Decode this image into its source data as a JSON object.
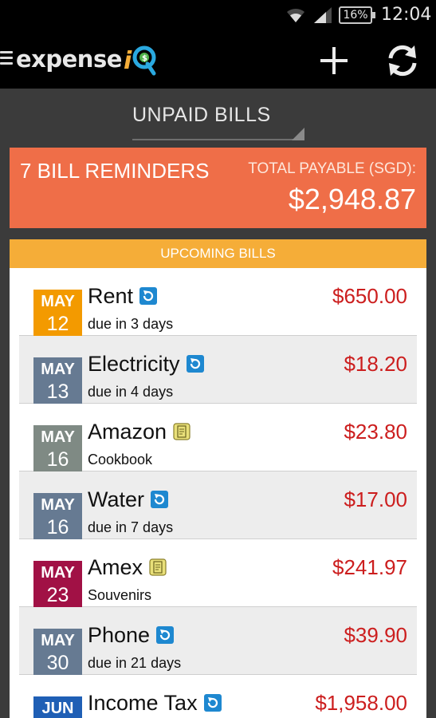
{
  "status_bar": {
    "battery": "16%",
    "time": "12:04"
  },
  "action_bar": {
    "logo_text": "expense",
    "logo_accent": "iQ",
    "icons": [
      "menu-icon",
      "plus-icon",
      "refresh-icon"
    ]
  },
  "spinner": {
    "selected": "UNPAID BILLS"
  },
  "summary": {
    "count_label": "7 BILL REMINDERS",
    "total_label": "TOTAL PAYABLE (SGD):",
    "total_value": "$2,948.87"
  },
  "list": {
    "header": "UPCOMING BILLS",
    "items": [
      {
        "month": "MAY",
        "day": "12",
        "name": "Rent",
        "sub": "due in 3 days",
        "amount": "$650.00",
        "icon": "recurring-icon",
        "badge_color": "#f39a00"
      },
      {
        "month": "MAY",
        "day": "13",
        "name": "Electricity",
        "sub": "due in 4 days",
        "amount": "$18.20",
        "icon": "recurring-icon",
        "badge_color": "#667a92"
      },
      {
        "month": "MAY",
        "day": "16",
        "name": "Amazon",
        "sub": "Cookbook",
        "amount": "$23.80",
        "icon": "note-icon",
        "badge_color": "#7f8a84"
      },
      {
        "month": "MAY",
        "day": "16",
        "name": "Water",
        "sub": "due in 7 days",
        "amount": "$17.00",
        "icon": "recurring-icon",
        "badge_color": "#667a92"
      },
      {
        "month": "MAY",
        "day": "23",
        "name": "Amex",
        "sub": "Souvenirs",
        "amount": "$241.97",
        "icon": "note-icon",
        "badge_color": "#a11145"
      },
      {
        "month": "MAY",
        "day": "30",
        "name": "Phone",
        "sub": "due in 21 days",
        "amount": "$39.90",
        "icon": "recurring-icon",
        "badge_color": "#667a92"
      },
      {
        "month": "JUN",
        "day": "",
        "name": "Income Tax",
        "sub": "",
        "amount": "$1,958.00",
        "icon": "recurring-icon",
        "badge_color": "#1f5fb5"
      }
    ]
  },
  "colors": {
    "summary_bg": "#ef6e48",
    "header_bg": "#f5ad38",
    "amount": "#cc1e1e",
    "recurring_icon": "#1e88d0",
    "note_icon": "#e9e07a"
  }
}
